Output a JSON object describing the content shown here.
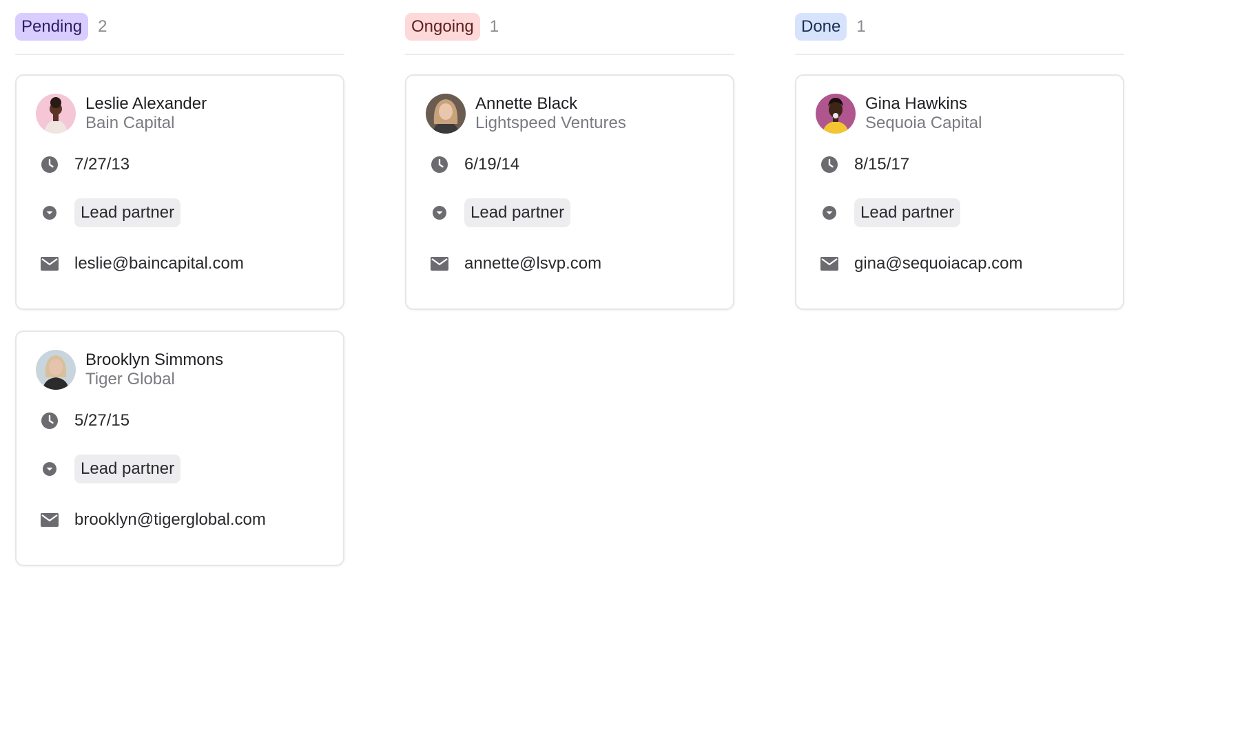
{
  "columns": [
    {
      "status": "Pending",
      "count": "2",
      "tag_bg": "#d9ccff",
      "tag_color": "#2d1e63",
      "cards": [
        {
          "name": "Leslie Alexander",
          "company": "Bain Capital",
          "date": "7/27/13",
          "role": "Lead partner",
          "email": "leslie@baincapital.com",
          "avatar_bg": "#f4c6d6",
          "avatar_skin": "#5a3424",
          "avatar_hair": "#2a1a14",
          "avatar_shirt": "#efe6e2"
        },
        {
          "name": "Brooklyn Simmons",
          "company": "Tiger Global",
          "date": "5/27/15",
          "role": "Lead partner",
          "email": "brooklyn@tigerglobal.com",
          "avatar_bg": "#c9d5dc",
          "avatar_skin": "#e6c3ad",
          "avatar_hair": "#d8c09a",
          "avatar_shirt": "#2b2b2b"
        }
      ]
    },
    {
      "status": "Ongoing",
      "count": "1",
      "tag_bg": "#fdd9d9",
      "tag_color": "#5e1e1e",
      "cards": [
        {
          "name": "Annette Black",
          "company": "Lightspeed Ventures",
          "date": "6/19/14",
          "role": "Lead partner",
          "email": "annette@lsvp.com",
          "avatar_bg": "#6b5c52",
          "avatar_skin": "#e9c7ad",
          "avatar_hair": "#c7a27a",
          "avatar_shirt": "#3a3a3a"
        }
      ]
    },
    {
      "status": "Done",
      "count": "1",
      "tag_bg": "#d6e3fb",
      "tag_color": "#1b2e55",
      "cards": [
        {
          "name": "Gina Hawkins",
          "company": "Sequoia Capital",
          "date": "8/15/17",
          "role": "Lead partner",
          "email": "gina@sequoiacap.com",
          "avatar_bg": "#b0568e",
          "avatar_skin": "#3f2418",
          "avatar_hair": "#1a0f0c",
          "avatar_shirt": "#f2c531"
        }
      ]
    }
  ],
  "icons": {
    "date": "clock-icon",
    "role": "chevron-down-circle-icon",
    "email": "mail-icon"
  }
}
